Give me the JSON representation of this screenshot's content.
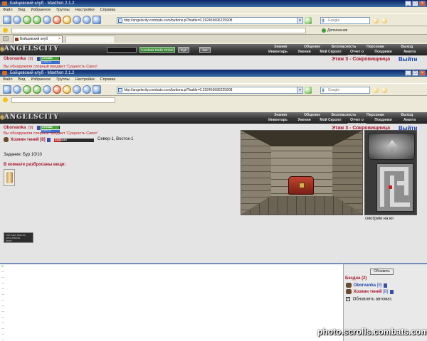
{
  "app": {
    "title": "Бойцовский клуб - Maxthon 2.1.2",
    "menu": [
      "Файл",
      "Вид",
      "Избранное",
      "Группы",
      "Настройки",
      "Справка"
    ],
    "address": "http://angelscity.combats.com/buttons.pl?battle=0.292459696225908",
    "search_placeholder": "Google",
    "addons_label": "Дополнения",
    "tab_label": "Бойцовский клуб"
  },
  "gamebar": {
    "logo": "ANGELSCITY",
    "radio_label": "Combats Radio Online",
    "btn_high": "high",
    "btn_low": "low",
    "nav_row1": [
      "Знания",
      "Общение",
      "Безопасность",
      "Персонаж",
      "Выход"
    ],
    "nav_row2": [
      "Инвентарь",
      "Умения",
      "Мой Скролл",
      "Отчет о переводах",
      "Поединки",
      "Анкета"
    ]
  },
  "game": {
    "username": "Oborvanka",
    "user_level": "[9]",
    "hp": "379/388",
    "mp": "120/120",
    "hp_ratio": 0.98,
    "mp_ratio": 1.0,
    "found_message": "Вы обнаружили спорный предмет 'Сущность Сапог'",
    "level_title": "Этаж 3 - Сокровищница",
    "exit_label": "Выйти",
    "monster_name": "Хозяин теней",
    "monster_level": "[8]",
    "monster_hp": "220/1320",
    "monster_hp_ratio": 0.17,
    "coords": "Север-1, Восток-1",
    "quest": "Задание: Бур 10/10",
    "items_header": "В комнате разбросаны вещи:",
    "looking": "смотрим на юг",
    "counter": [
      "TOP.TodeX 1990 2/0",
      "1PDA 2993204",
      "40038"
    ]
  },
  "side": {
    "refresh_label": "Обновить",
    "location": "Бездна (2)",
    "players": [
      {
        "name": "Oborvanka",
        "level": "[9]"
      },
      {
        "name": "Хозяин теней",
        "level": "[8]"
      }
    ],
    "auto_refresh": "Обновлять автомат."
  },
  "watermark": "photo.scrolls.combats.com",
  "colors": {
    "accent_red": "#a8162a",
    "link_blue": "#1a3fb0",
    "hp_green": "#4aa640",
    "mp_blue": "#3a6fd0"
  }
}
